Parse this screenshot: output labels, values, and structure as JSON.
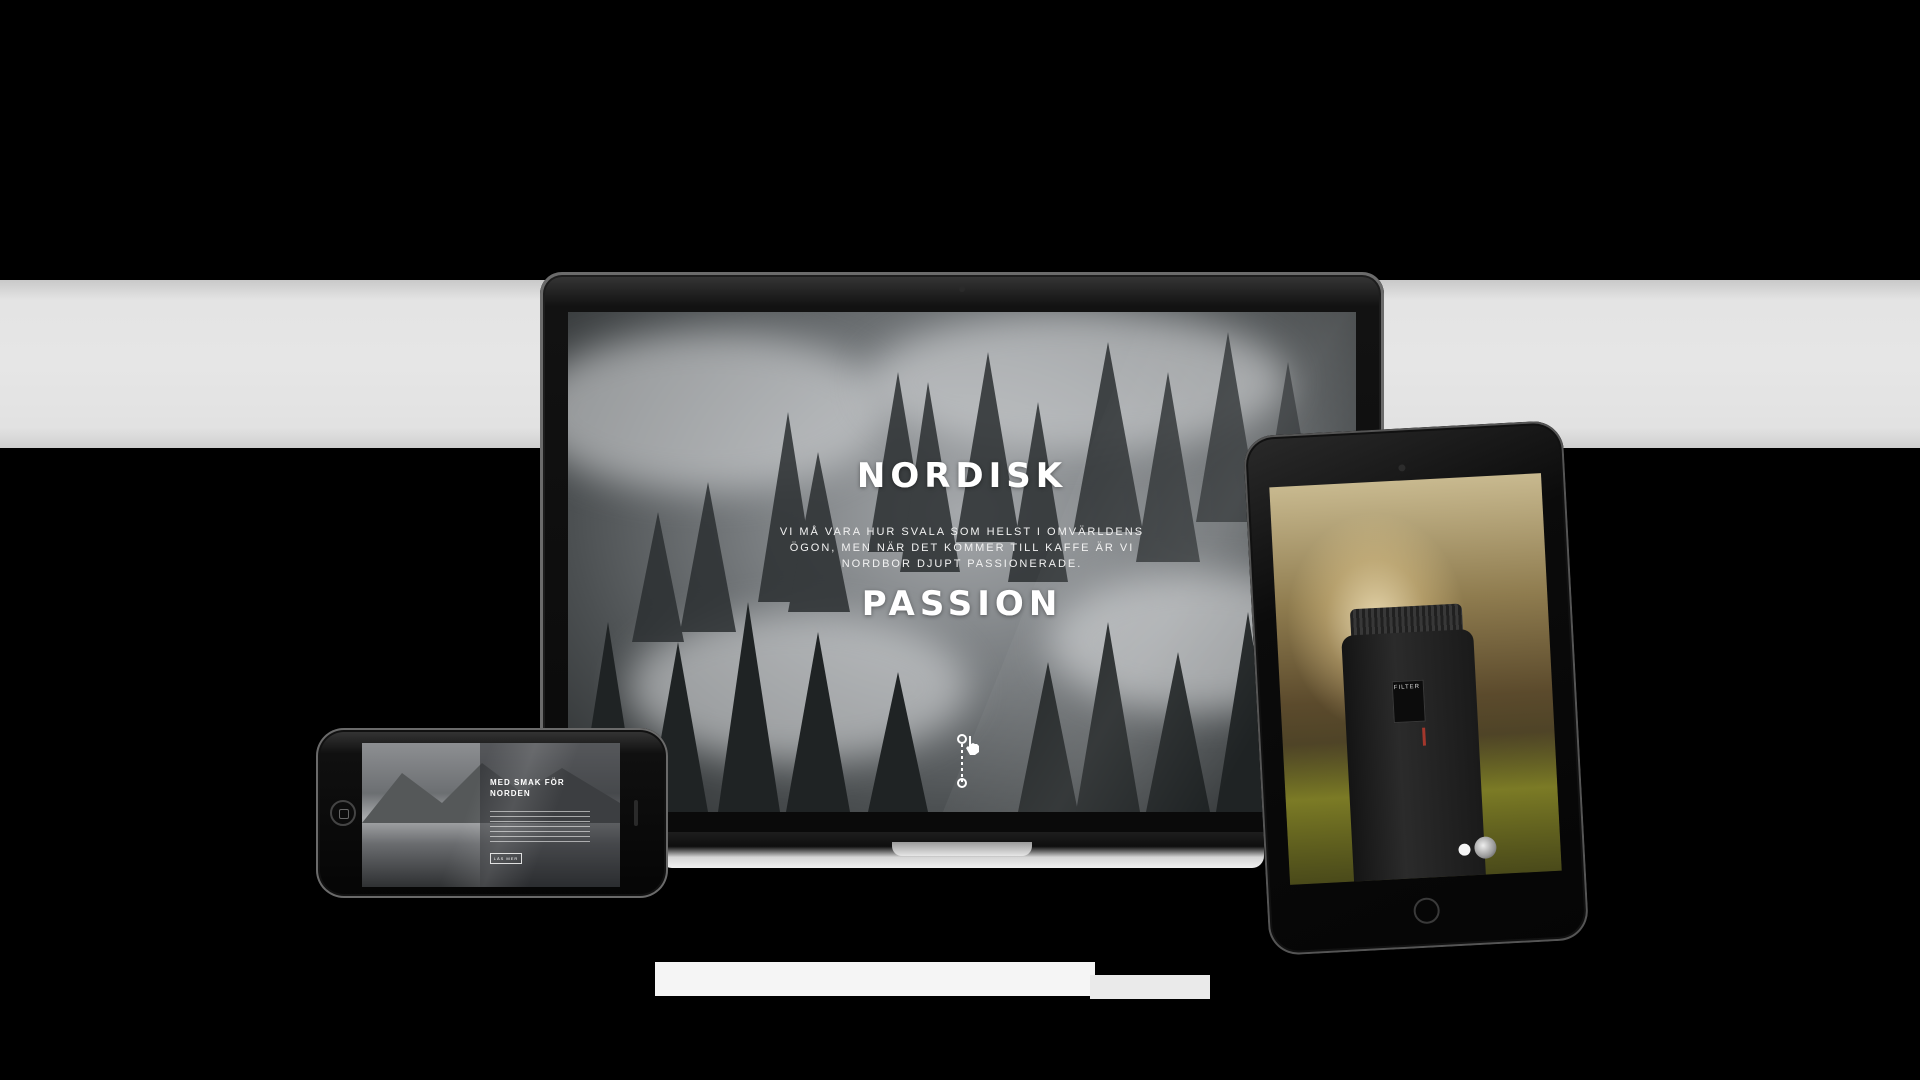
{
  "laptop": {
    "hero_title_top": "NORDISK",
    "hero_subtitle": "VI MÅ VARA HUR SVALA SOM HELST I OMVÄRLDENS ÖGON, MEN NÄR DET KOMMER TILL KAFFE ÄR VI NORDBOR DJUPT PASSIONERADE.",
    "hero_title_bottom": "PASSION"
  },
  "tablet": {
    "grinder_label": "FILTER"
  },
  "phone": {
    "title": "MED SMAK FÖR NORDEN",
    "button_label": "LÄS MER"
  },
  "colors": {
    "background": "#000000",
    "band": "#e4e4e4",
    "text": "#ffffff"
  }
}
